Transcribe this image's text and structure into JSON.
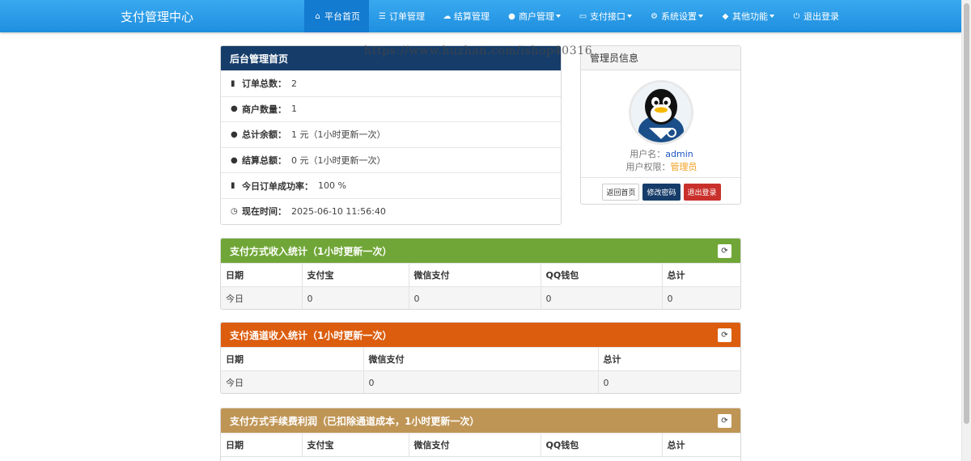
{
  "navbar": {
    "brand": "支付管理中心",
    "items": [
      {
        "label": "平台首页",
        "icon": "home-icon"
      },
      {
        "label": "订单管理",
        "icon": "list-icon"
      },
      {
        "label": "结算管理",
        "icon": "cloud-icon"
      },
      {
        "label": "商户管理",
        "icon": "user-icon"
      },
      {
        "label": "支付接口",
        "icon": "credit-card-icon"
      },
      {
        "label": "系统设置",
        "icon": "gear-icon"
      },
      {
        "label": "其他功能",
        "icon": "cube-icon"
      },
      {
        "label": "退出登录",
        "icon": "power-icon"
      }
    ]
  },
  "watermark": "https://www.huzhan.com/ishop40316",
  "home_panel": {
    "title": "后台管理首页",
    "stats": [
      {
        "label": "订单总数：",
        "value": "2",
        "icon": "bar-chart-icon"
      },
      {
        "label": "商户数量：",
        "value": "1",
        "icon": "drop-icon"
      },
      {
        "label": "总计余额：",
        "value": "1 元（1小时更新一次）",
        "icon": "drop-icon"
      },
      {
        "label": "结算总额：",
        "value": "0 元（1小时更新一次）",
        "icon": "drop-icon"
      },
      {
        "label": "今日订单成功率：",
        "value": "100 %",
        "icon": "bar-chart-icon"
      },
      {
        "label": "现在时间：",
        "value": "2025-06-10 11:56:40",
        "icon": "clock-icon"
      }
    ]
  },
  "admin_panel": {
    "title": "管理员信息",
    "username_label": "用户名：",
    "username": "admin",
    "role_label": "用户权限：",
    "role": "管理员",
    "buttons": {
      "home": "返回首页",
      "password": "修改密码",
      "logout": "退出登录"
    }
  },
  "payment_stats": {
    "title": "支付方式收入统计（1小时更新一次）",
    "headers": [
      "日期",
      "支付宝",
      "微信支付",
      "QQ钱包",
      "总计"
    ],
    "rows": [
      [
        "今日",
        "0",
        "0",
        "0",
        "0"
      ]
    ]
  },
  "channel_stats": {
    "title": "支付通道收入统计（1小时更新一次）",
    "headers": [
      "日期",
      "微信支付",
      "总计"
    ],
    "rows": [
      [
        "今日",
        "0",
        "0"
      ]
    ]
  },
  "fee_stats": {
    "title": "支付方式手续费利润（已扣除通道成本，1小时更新一次）",
    "headers": [
      "日期",
      "支付宝",
      "微信支付",
      "QQ钱包",
      "总计"
    ]
  },
  "colors": {
    "navbar": "#2196e8",
    "home_header": "#163d6a",
    "payment_header": "#70a637",
    "channel_header": "#dc5d0e",
    "fee_header": "#bf9555"
  }
}
